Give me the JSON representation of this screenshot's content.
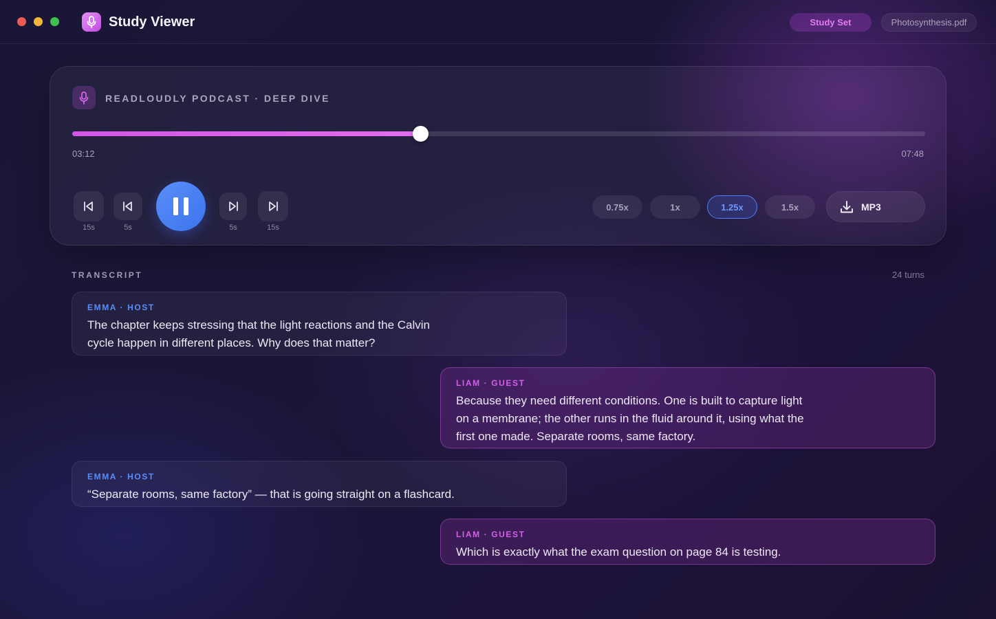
{
  "app": {
    "title": "Study Viewer",
    "tabs": [
      "Study Set",
      "Photosynthesis.pdf"
    ]
  },
  "player": {
    "title": "READLOUDLY PODCAST · DEEP DIVE",
    "current_time": "03:12",
    "total_time": "07:48",
    "progress": 0.408,
    "controls": {
      "back_15_label": "15s",
      "back_5_label": "5s",
      "forward_5_label": "5s",
      "forward_15_label": "15s",
      "state": "playing"
    },
    "speeds": [
      "0.75x",
      "1x",
      "1.25x",
      "1.5x"
    ],
    "active_speed": "1.25x",
    "download_label": "MP3"
  },
  "transcript": {
    "heading": "TRANSCRIPT",
    "turn_count": "24 turns",
    "turns": [
      {
        "speaker": "EMMA · HOST",
        "role": "host",
        "text": "The chapter keeps stressing that the light reactions and the Calvin cycle happen in different places. Why does that matter?"
      },
      {
        "speaker": "LIAM · GUEST",
        "role": "guest",
        "text": "Because they need different conditions. One is built to capture light on a membrane; the other runs in the fluid around it, using what the first one made. Separate rooms, same factory."
      },
      {
        "speaker": "EMMA · HOST",
        "role": "host",
        "text": "“Separate rooms, same factory” — that is going straight on a flashcard."
      },
      {
        "speaker": "LIAM · GUEST",
        "role": "guest",
        "text": "Which is exactly what the exam question on page 84 is testing."
      }
    ]
  },
  "colors": {
    "accent_pink": "#d555e6",
    "accent_blue": "#4f7ff5"
  },
  "icons": {
    "logo": "microphone-icon",
    "badge": "microphone-icon",
    "download": "download-icon"
  }
}
